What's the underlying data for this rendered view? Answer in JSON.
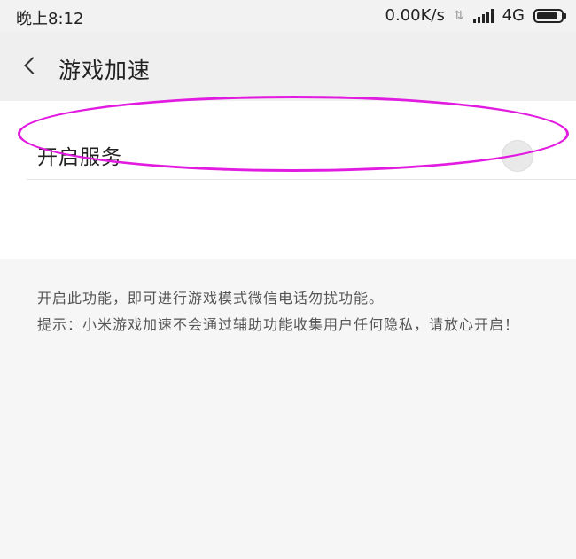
{
  "status_bar": {
    "time": "晚上8:12",
    "speed": "0.00K/s",
    "data_icon": "data-transfer-arrows-icon",
    "signal_icon": "cell-signal-icon",
    "network": "4G",
    "battery_icon": "battery-icon",
    "battery_level": 0.9
  },
  "header": {
    "back_icon": "chevron-left-icon",
    "title": "游戏加速"
  },
  "settings": {
    "service_label": "开启服务",
    "toggle_on": false,
    "description_line1": "开启此功能，即可进行游戏模式微信电话勿扰功能。",
    "description_line2": "提示：小米游戏加速不会通过辅助功能收集用户任何隐私，请放心开启！"
  },
  "annotation": {
    "highlight_color": "#e21be0"
  }
}
